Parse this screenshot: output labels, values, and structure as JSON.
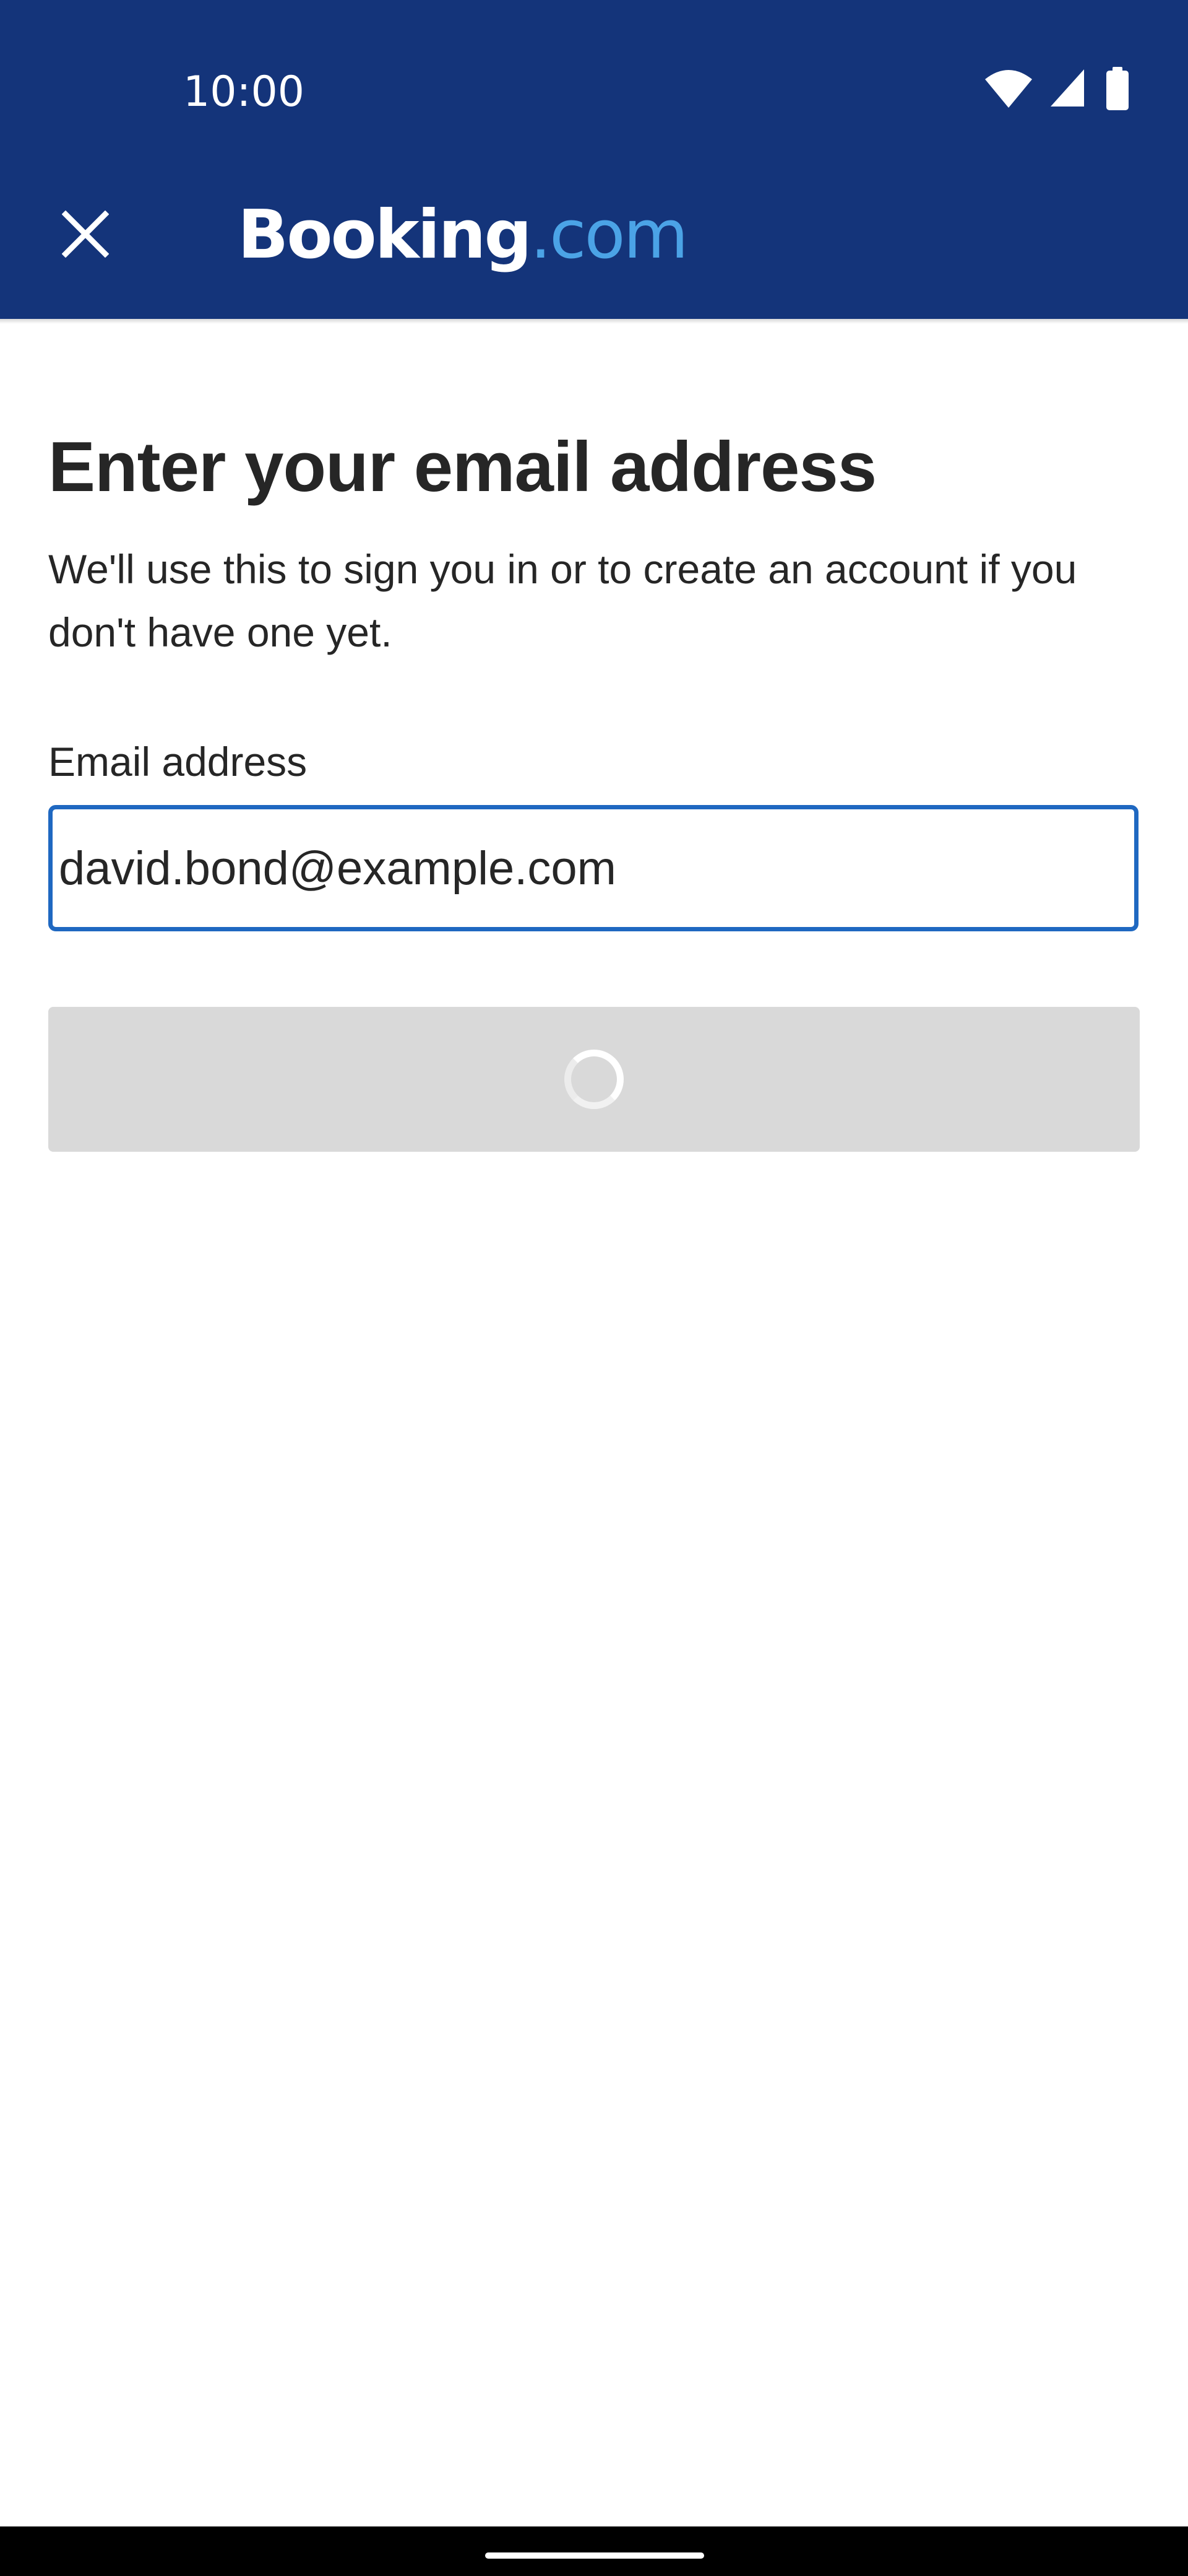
{
  "status_bar": {
    "time": "10:00",
    "icons": [
      "wifi-icon",
      "cell-signal-icon",
      "battery-icon"
    ]
  },
  "app_bar": {
    "close_icon": "close-icon",
    "brand_name": "Booking",
    "brand_suffix": ".com"
  },
  "main": {
    "heading": "Enter your email address",
    "subtitle": "We'll use this to sign you in or to create an account if you don't have one yet.",
    "email_label": "Email address",
    "email_value": "david.bond@example.com",
    "submit_state": "loading"
  },
  "colors": {
    "brand_navy": "#14347a",
    "brand_light_blue": "#4ba3e6",
    "input_focus_border": "#1f68c1",
    "disabled_button": "#d9d9d9"
  }
}
